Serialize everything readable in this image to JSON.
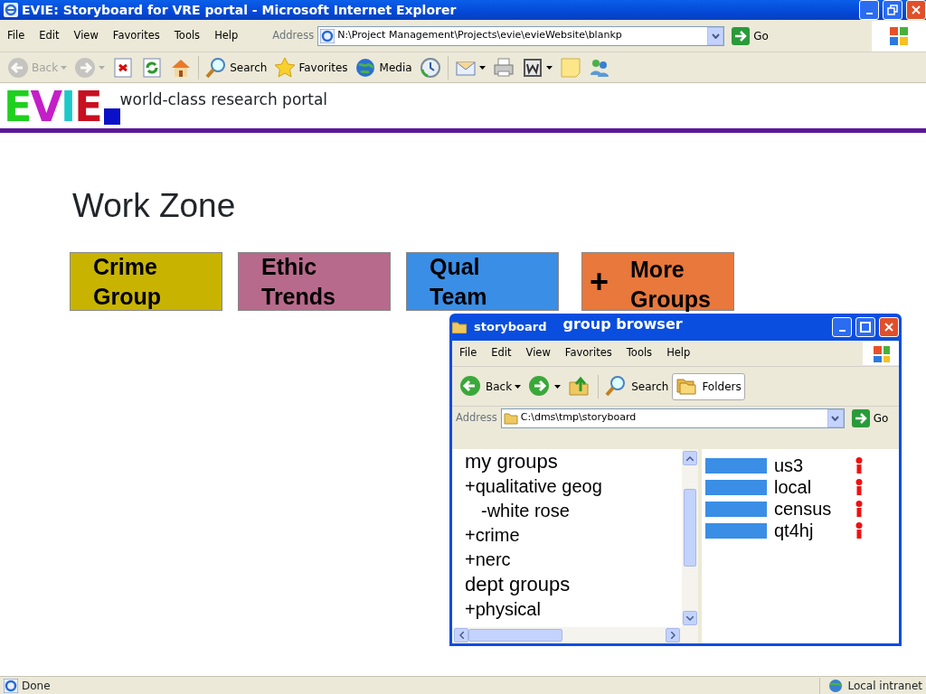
{
  "window": {
    "title": "EVIE: Storyboard for VRE portal - Microsoft Internet Explorer"
  },
  "menu": [
    "File",
    "Edit",
    "View",
    "Favorites",
    "Tools",
    "Help"
  ],
  "address": {
    "label": "Address",
    "value": "N:\\Project Management\\Projects\\evie\\evieWebsite\\blankp",
    "go": "Go"
  },
  "toolbar": [
    {
      "kind": "back",
      "label": "Back",
      "disabled": true
    },
    {
      "kind": "forward",
      "disabled": true
    },
    {
      "kind": "stop",
      "disabled": false
    },
    {
      "kind": "refresh",
      "disabled": false
    },
    {
      "kind": "home",
      "disabled": false
    },
    {
      "kind": "search",
      "label": "Search",
      "disabled": false
    },
    {
      "kind": "favorites",
      "label": "Favorites",
      "disabled": false
    },
    {
      "kind": "media",
      "label": "Media",
      "disabled": false
    },
    {
      "kind": "history",
      "disabled": false
    },
    {
      "kind": "mail",
      "disabled": false
    },
    {
      "kind": "print",
      "disabled": false
    },
    {
      "kind": "edit",
      "disabled": false
    },
    {
      "kind": "note",
      "disabled": false
    },
    {
      "kind": "messenger",
      "disabled": false
    }
  ],
  "page": {
    "logo": {
      "letters": [
        {
          "char": "E",
          "color": "#1fd01f"
        },
        {
          "char": "V",
          "color": "#c41ec8"
        },
        {
          "char": "I",
          "color": "#1ec8c8"
        },
        {
          "char": "E",
          "color": "#c81020"
        }
      ],
      "tagline": "world-class research portal"
    },
    "heading": "Work Zone",
    "groups": [
      {
        "kind": "group",
        "label": "Crime Group",
        "color": "#c8b400"
      },
      {
        "kind": "group",
        "label": "Ethic Trends",
        "color": "#b86a8c"
      },
      {
        "kind": "group",
        "label": "Qual Team",
        "color": "#3a8ee6"
      },
      {
        "kind": "more",
        "icon": "+",
        "label": "More Groups",
        "color": "#e8783c"
      }
    ]
  },
  "browser": {
    "title": "storyboard",
    "subtitle": "group browser",
    "menu": [
      "File",
      "Edit",
      "View",
      "Favorites",
      "Tools",
      "Help"
    ],
    "toolbar": [
      {
        "kind": "back",
        "label": "Back",
        "selected": false
      },
      {
        "kind": "forward",
        "selected": false
      },
      {
        "kind": "up",
        "selected": false
      },
      {
        "kind": "search",
        "label": "Search",
        "selected": false
      },
      {
        "kind": "folders",
        "label": "Folders",
        "selected": true
      }
    ],
    "address": {
      "label": "Address",
      "value": "C:\\dms\\tmp\\storyboard",
      "go": "Go"
    },
    "tree": [
      {
        "kind": "heading",
        "label": "my groups",
        "children": [
          {
            "kind": "item",
            "label": "+qualitative geog",
            "children": [
              {
                "kind": "item",
                "label": "-white rose"
              }
            ]
          },
          {
            "kind": "item",
            "label": "+crime"
          },
          {
            "kind": "item",
            "label": "+nerc"
          }
        ]
      },
      {
        "kind": "heading",
        "label": "dept groups",
        "children": [
          {
            "kind": "item",
            "label": "+physical"
          }
        ]
      }
    ],
    "items": [
      {
        "label": "us3"
      },
      {
        "label": "local"
      },
      {
        "label": "census"
      },
      {
        "label": "qt4hj"
      }
    ]
  },
  "status_bar": {
    "text": "Done",
    "zone": "Local intranet"
  }
}
